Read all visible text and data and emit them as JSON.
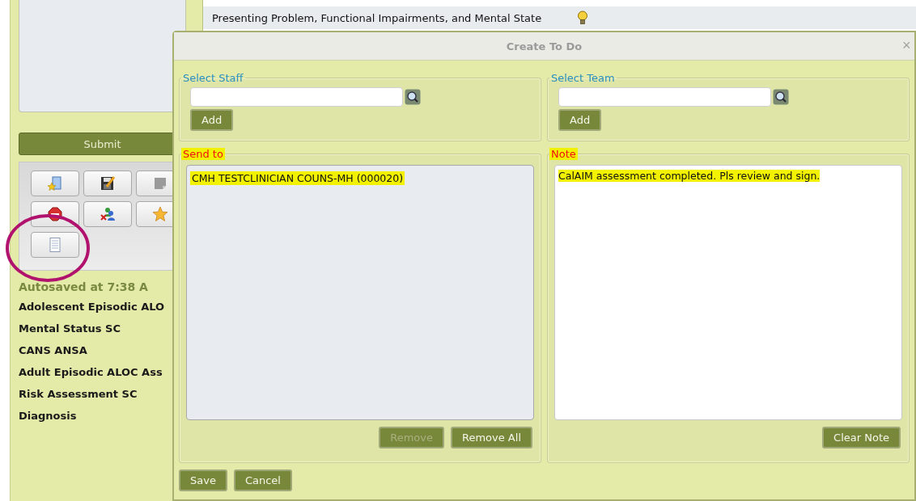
{
  "background_form": {
    "section_title": "Presenting Problem, Functional Impairments, and Mental State"
  },
  "sidebar": {
    "submit_button": "Submit",
    "autosave_status": "Autosaved at 7:38 A",
    "tools": [
      {
        "kind": "document-star"
      },
      {
        "kind": "save-edit"
      },
      {
        "kind": "note"
      },
      {
        "kind": "stop"
      },
      {
        "kind": "people-remove"
      },
      {
        "kind": "star"
      },
      {
        "kind": "list"
      }
    ],
    "documents": [
      "Adolescent Episodic ALO",
      "Mental Status SC",
      "CANS ANSA",
      "Adult Episodic ALOC Ass",
      "Risk Assessment SC",
      "Diagnosis"
    ]
  },
  "dialog": {
    "title": "Create To Do",
    "close": "×",
    "select_staff": {
      "legend": "Select Staff",
      "add_button": "Add"
    },
    "select_team": {
      "legend": "Select Team",
      "add_button": "Add"
    },
    "send_to": {
      "legend": "Send to",
      "highlighted": true,
      "recipients": [
        {
          "name": "CMH TESTCLINICIAN COUNS-MH (000020)",
          "highlighted": true
        }
      ],
      "buttons": [
        {
          "label": "Remove",
          "disabled": true
        },
        {
          "label": "Remove All",
          "disabled": false
        }
      ]
    },
    "note": {
      "legend": "Note",
      "highlighted": true,
      "value": "CalAIM assessment completed. Pls review and sign.",
      "value_highlighted": true,
      "clear_button": "Clear Note"
    },
    "buttons": [
      "Save",
      "Cancel"
    ]
  }
}
